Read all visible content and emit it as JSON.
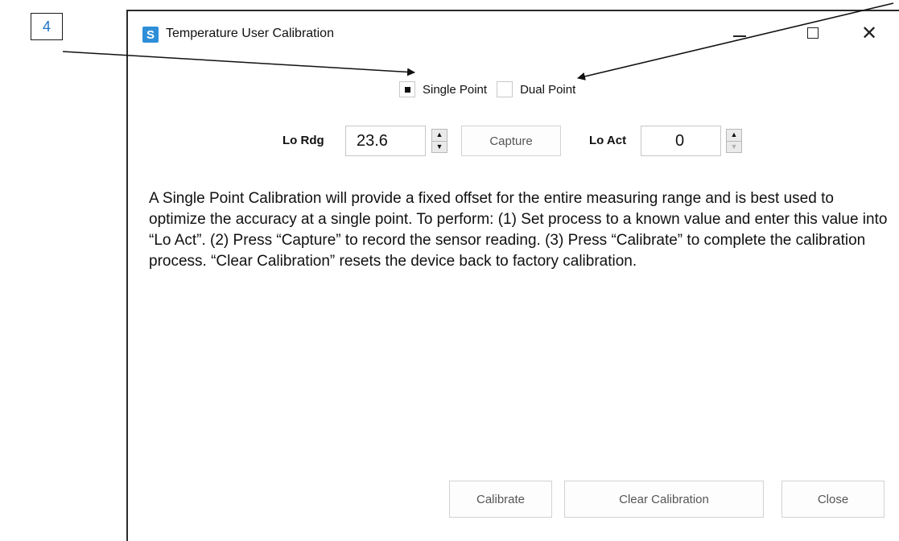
{
  "callout": {
    "number": "4"
  },
  "window": {
    "title": "Temperature User Calibration",
    "app_icon_glyph": "S",
    "controls": {
      "minimize": "minimize-icon",
      "maximize": "maximize-icon",
      "close": "close-icon"
    }
  },
  "mode": {
    "single_point_label": "Single Point",
    "dual_point_label": "Dual Point",
    "selected": "Single Point"
  },
  "reading": {
    "lo_rdg_label": "Lo Rdg",
    "lo_rdg_value": "23.6",
    "capture_label": "Capture",
    "lo_act_label": "Lo Act",
    "lo_act_value": "0"
  },
  "description": "A Single Point Calibration will provide a fixed offset for the entire measuring range and is best used to optimize the accuracy at a single point. To perform: (1) Set process to a known value and enter this value into “Lo Act”. (2) Press “Capture” to record the sensor reading. (3) Press “Calibrate” to complete the calibration process. “Clear Calibration” resets the device back to factory calibration.",
  "footer": {
    "calibrate_label": "Calibrate",
    "clear_calibration_label": "Clear Calibration",
    "close_label": "Close"
  },
  "colors": {
    "callout_text": "#1e73c8",
    "app_icon": "#2e8fd8"
  }
}
